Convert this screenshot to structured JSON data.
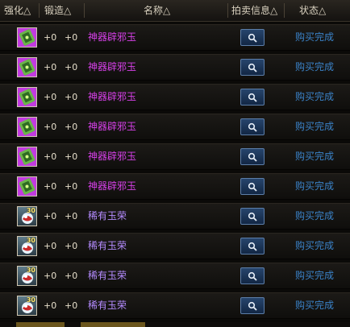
{
  "header": {
    "col_enhance": "强化△",
    "col_forge": "锻造△",
    "col_name": "名称△",
    "col_auction": "拍卖信息△",
    "col_status": "状态△"
  },
  "rows": [
    {
      "enhance": "+0",
      "forge": "+0",
      "name": "神器辟邪玉",
      "status": "购买完成"
    },
    {
      "enhance": "+0",
      "forge": "+0",
      "name": "神器辟邪玉",
      "status": "购买完成"
    },
    {
      "enhance": "+0",
      "forge": "+0",
      "name": "神器辟邪玉",
      "status": "购买完成"
    },
    {
      "enhance": "+0",
      "forge": "+0",
      "name": "神器辟邪玉",
      "status": "购买完成"
    },
    {
      "enhance": "+0",
      "forge": "+0",
      "name": "神器辟邪玉",
      "status": "购买完成"
    },
    {
      "enhance": "+0",
      "forge": "+0",
      "name": "神器辟邪玉",
      "status": "购买完成"
    },
    {
      "enhance": "+0",
      "forge": "+0",
      "name": "稀有玉荣",
      "status": "购买完成",
      "level": "30"
    },
    {
      "enhance": "+0",
      "forge": "+0",
      "name": "稀有玉荣",
      "status": "购买完成",
      "level": "30"
    },
    {
      "enhance": "+0",
      "forge": "+0",
      "name": "稀有玉荣",
      "status": "购买完成",
      "level": "30"
    },
    {
      "enhance": "+0",
      "forge": "+0",
      "name": "稀有玉荣",
      "status": "购买完成",
      "level": "30"
    }
  ],
  "icons": {
    "epic_item": "jade-card-icon",
    "rare_item": "jade-orb-icon",
    "auction_button": "search-icon"
  },
  "colors": {
    "epic_name": "#d640e8",
    "rare_name": "#b58cff",
    "status": "#3a82c8",
    "header_text": "#d9d1bf"
  }
}
